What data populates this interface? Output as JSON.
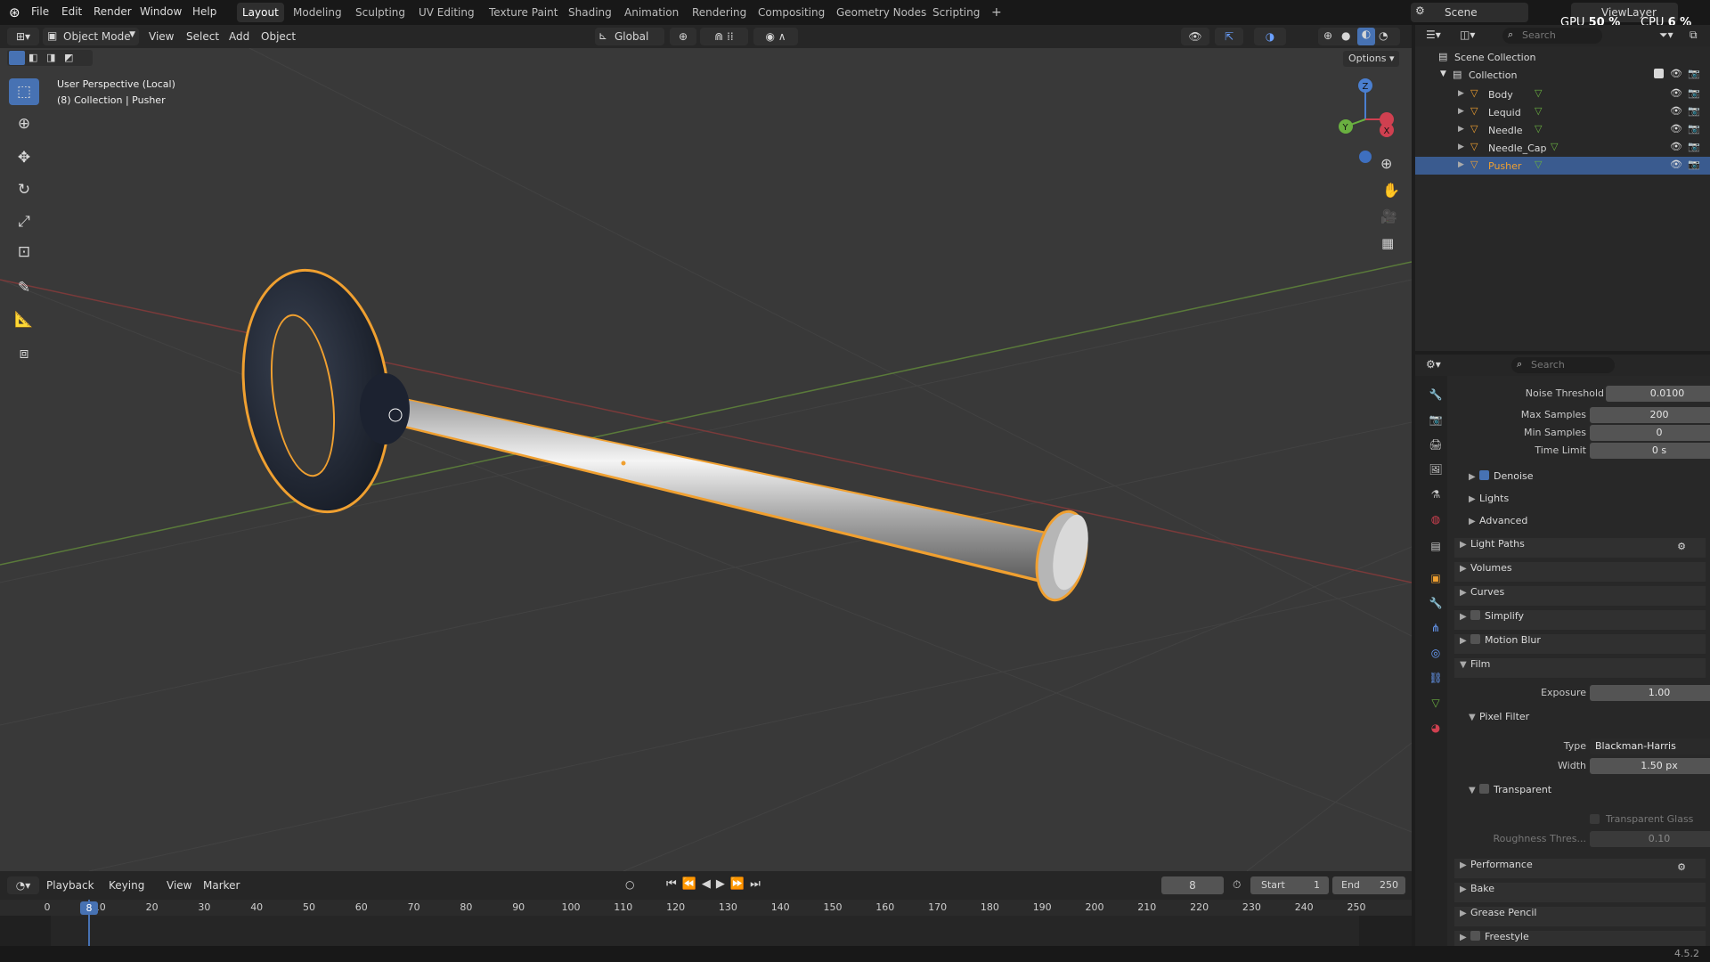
{
  "app": {
    "name": "Blender",
    "version": "4.5.2"
  },
  "menu": [
    "File",
    "Edit",
    "Render",
    "Window",
    "Help"
  ],
  "workspaces": [
    "Layout",
    "Modeling",
    "Sculpting",
    "UV Editing",
    "Texture Paint",
    "Shading",
    "Animation",
    "Rendering",
    "Compositing",
    "Geometry Nodes",
    "Scripting"
  ],
  "workspace_add": "+",
  "scene_name": "Scene",
  "view_layer": "ViewLayer",
  "stats": {
    "gpu_label": "GPU",
    "gpu_value": "50 %",
    "cpu_label": "CPU",
    "cpu_value": "6 %"
  },
  "viewport_header": {
    "mode": "Object Mode",
    "menus": [
      "View",
      "Select",
      "Add",
      "Object"
    ],
    "orientation": "Global",
    "options": "Options"
  },
  "viewport_overlay": {
    "line1": "User Perspective (Local)",
    "line2": "(8) Collection | Pusher"
  },
  "gizmo_axes": [
    "Z",
    "Y",
    "X"
  ],
  "outliner": {
    "search_placeholder": "Search",
    "scene_collection": "Scene Collection",
    "collection": "Collection",
    "objects": [
      "Body",
      "Lequid",
      "Needle",
      "Needle_Cap",
      "Pusher"
    ],
    "selected": "Pusher"
  },
  "properties": {
    "search_placeholder": "Search",
    "rows": [
      {
        "label": "Noise Threshold",
        "value": "0.0100",
        "checkbox": true
      },
      {
        "label": "Max Samples",
        "value": "200"
      },
      {
        "label": "Min Samples",
        "value": "0"
      },
      {
        "label": "Time Limit",
        "value": "0 s"
      }
    ],
    "subpanels": [
      {
        "label": "Denoise",
        "checkbox": true
      },
      {
        "label": "Lights"
      },
      {
        "label": "Advanced"
      }
    ],
    "panels": [
      "Light Paths",
      "Volumes",
      "Curves",
      "Simplify",
      "Motion Blur"
    ],
    "film": {
      "title": "Film",
      "exposure_label": "Exposure",
      "exposure_value": "1.00",
      "pixel_filter": "Pixel Filter",
      "type_label": "Type",
      "type_value": "Blackman-Harris",
      "width_label": "Width",
      "width_value": "1.50 px",
      "transparent": "Transparent",
      "transparent_glass": "Transparent Glass",
      "roughness_label": "Roughness Thres...",
      "roughness_value": "0.10"
    },
    "panels_after": [
      "Performance",
      "Bake",
      "Grease Pencil",
      "Freestyle"
    ]
  },
  "timeline": {
    "menus": [
      "Playback",
      "Keying",
      "View",
      "Marker"
    ],
    "current_frame": "8",
    "start_label": "Start",
    "start_value": "1",
    "end_label": "End",
    "end_value": "250",
    "ticks": [
      "0",
      "10",
      "20",
      "30",
      "40",
      "50",
      "60",
      "70",
      "80",
      "90",
      "100",
      "110",
      "120",
      "130",
      "140",
      "150",
      "160",
      "170",
      "180",
      "190",
      "200",
      "210",
      "220",
      "230",
      "240",
      "250"
    ],
    "playhead_label": "8"
  },
  "colors": {
    "accent": "#4772b3",
    "selection_outline": "#f0a030",
    "header": "#262626",
    "viewport": "#393939"
  }
}
